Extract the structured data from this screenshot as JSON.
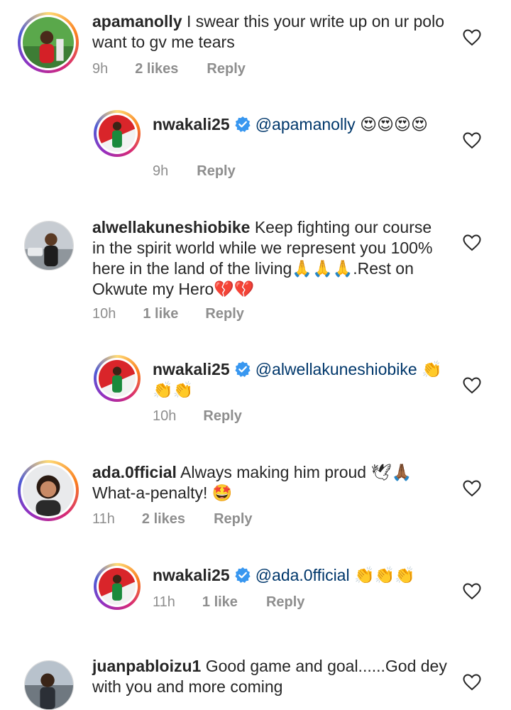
{
  "comments": [
    {
      "username": "apamanolly",
      "text": "I swear this your write up on ur polo want to gv me tears",
      "time": "9h",
      "likes": "2 likes",
      "reply": "Reply"
    },
    {
      "username": "nwakali25",
      "mention": "@apamanolly",
      "text": "😍😍😍😍",
      "time": "9h",
      "reply": "Reply"
    },
    {
      "username": "alwellakuneshiobike",
      "text": "Keep fighting our course in the spirit world while we represent you 100% here in the land of the living🙏🙏🙏.Rest on Okwute my Hero💔💔",
      "time": "10h",
      "likes": "1 like",
      "reply": "Reply"
    },
    {
      "username": "nwakali25",
      "mention": "@alwellakuneshiobike",
      "text": "👏👏👏",
      "time": "10h",
      "reply": "Reply"
    },
    {
      "username": "ada.0fficial",
      "text": "Always making him proud 🕊🙏🏾 What-a-penalty! 🤩",
      "time": "11h",
      "likes": "2 likes",
      "reply": "Reply"
    },
    {
      "username": "nwakali25",
      "mention": "@ada.0fficial",
      "text": "👏👏👏",
      "time": "11h",
      "likes": "1 like",
      "reply": "Reply"
    },
    {
      "username": "juanpabloizu1",
      "text": "Good game and goal......God dey with you and more coming"
    }
  ],
  "icons": {
    "like": "heart-outline-icon",
    "verified": "verified-badge-icon"
  },
  "colors": {
    "mention": "#00376b",
    "meta": "#8e8e8e",
    "verified": "#3897f0"
  }
}
